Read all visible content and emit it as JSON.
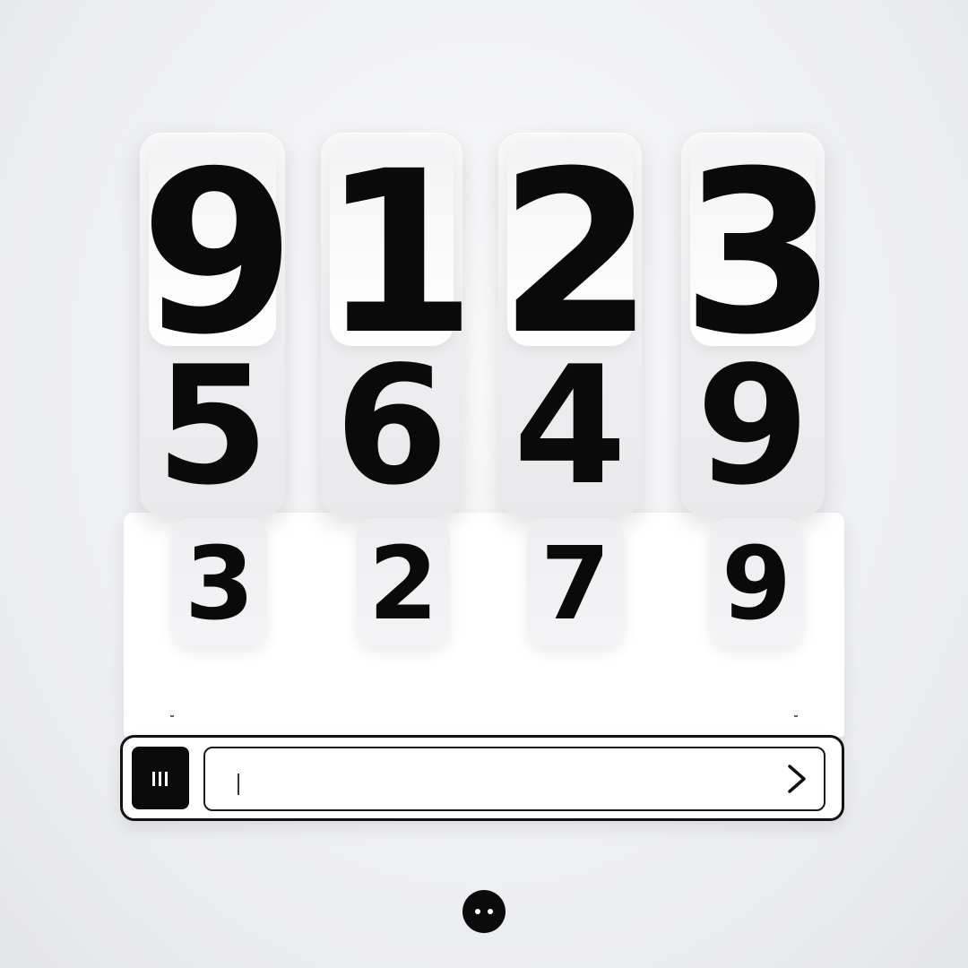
{
  "columns": [
    {
      "top": "9",
      "middle": "5",
      "bottom": "3"
    },
    {
      "top": "1",
      "middle": "6",
      "bottom": "2"
    },
    {
      "top": "2",
      "middle": "4",
      "bottom": "7"
    },
    {
      "top": "3",
      "middle": "9",
      "bottom": "9"
    }
  ],
  "input": {
    "value": "",
    "placeholder": ""
  },
  "icons": {
    "menu": "menu-bars-icon",
    "submit": "chevron-right-icon",
    "assistant": "bot-face-icon"
  },
  "colors": {
    "ink": "#0b0b0b",
    "background": "#eeeff2",
    "panel": "#ffffff"
  }
}
